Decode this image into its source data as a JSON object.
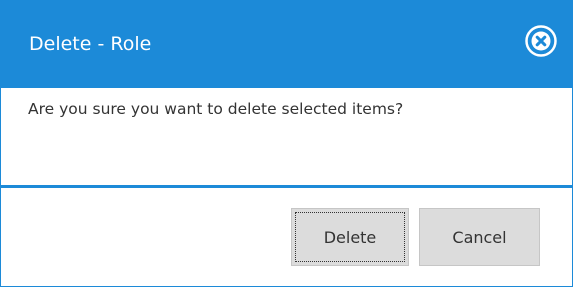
{
  "dialog": {
    "title": "Delete - Role",
    "close_icon": "close-x-circle-icon",
    "message": "Are you sure you want to delete selected items?",
    "buttons": {
      "delete_label": "Delete",
      "cancel_label": "Cancel"
    }
  },
  "colors": {
    "accent": "#1c8ad8",
    "button_bg": "#dcdcdc",
    "text": "#333333",
    "title_text": "#ffffff"
  }
}
